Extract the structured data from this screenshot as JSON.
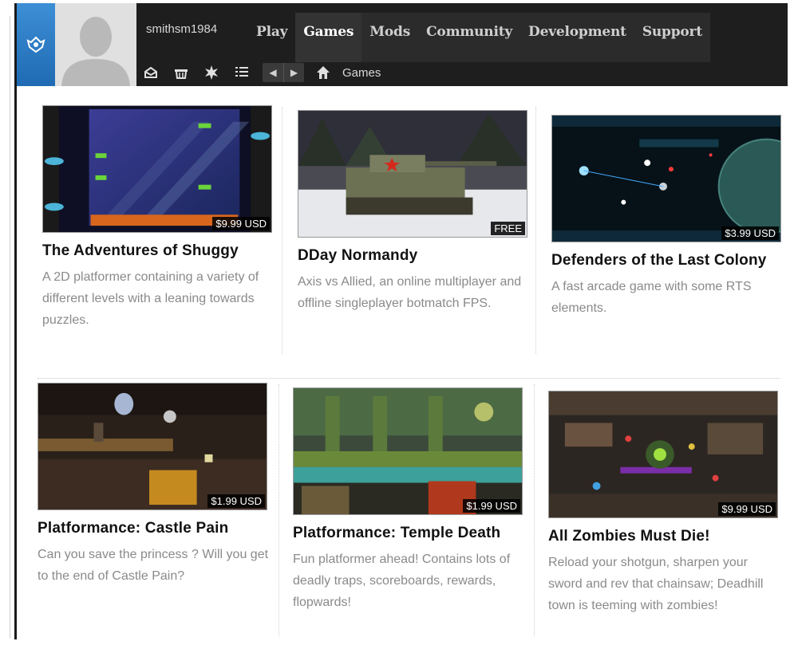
{
  "header": {
    "username": "smithsm1984",
    "nav": [
      {
        "label": "Play"
      },
      {
        "label": "Games"
      },
      {
        "label": "Mods"
      },
      {
        "label": "Community"
      },
      {
        "label": "Development"
      },
      {
        "label": "Support"
      }
    ],
    "active_nav": "Games",
    "breadcrumb": "Games",
    "icons": [
      "logo-icon",
      "inbox-icon",
      "basket-icon",
      "starburst-icon",
      "list-icon",
      "back-arrow-icon",
      "forward-arrow-icon",
      "home-icon"
    ]
  },
  "games": [
    {
      "title": "The Adventures of Shuggy",
      "price": "$9.99 USD",
      "description": "A 2D platformer containing a variety of different levels with a leaning towards puzzles."
    },
    {
      "title": "DDay Normandy",
      "price": "FREE",
      "description": "Axis vs Allied, an online multiplayer and offline singleplayer botmatch FPS."
    },
    {
      "title": "Defenders of the Last Colony",
      "price": "$3.99 USD",
      "description": "A fast arcade game with some RTS elements."
    },
    {
      "title": "Platformance: Castle Pain",
      "price": "$1.99 USD",
      "description": "Can you save the princess ? Will you get to the end of Castle Pain?"
    },
    {
      "title": "Platformance: Temple Death",
      "price": "$1.99 USD",
      "description": "Fun platformer ahead! Contains lots of deadly traps, scoreboards, rewards, flopwards!"
    },
    {
      "title": "All Zombies Must Die!",
      "price": "$9.99 USD",
      "description": "Reload your shotgun, sharpen your sword and rev that chainsaw; Deadhill town is teeming with zombies!"
    }
  ],
  "colors": {
    "header_bg": "#1e1e1e",
    "logo_blue": "#2a7ccc",
    "title": "#111111",
    "description": "#8a8a8a"
  }
}
